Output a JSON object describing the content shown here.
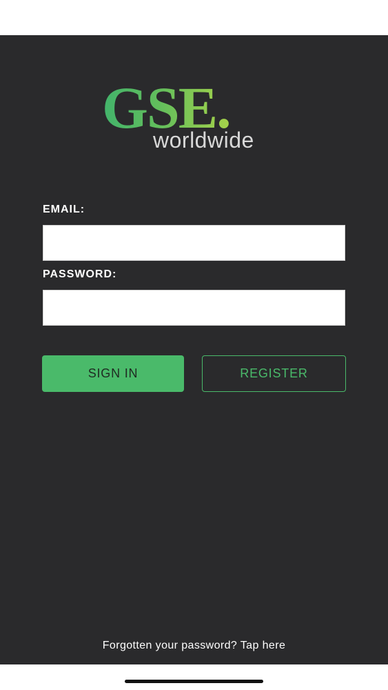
{
  "logo": {
    "main": "GSE.",
    "sub": "worldwide"
  },
  "form": {
    "email_label": "EMAIL:",
    "email_value": "",
    "password_label": "PASSWORD:",
    "password_value": ""
  },
  "buttons": {
    "sign_in": "SIGN IN",
    "register": "REGISTER"
  },
  "forgot_password": "Forgotten your password? Tap here",
  "colors": {
    "background": "#2a2a2c",
    "accent": "#4aba6a"
  }
}
